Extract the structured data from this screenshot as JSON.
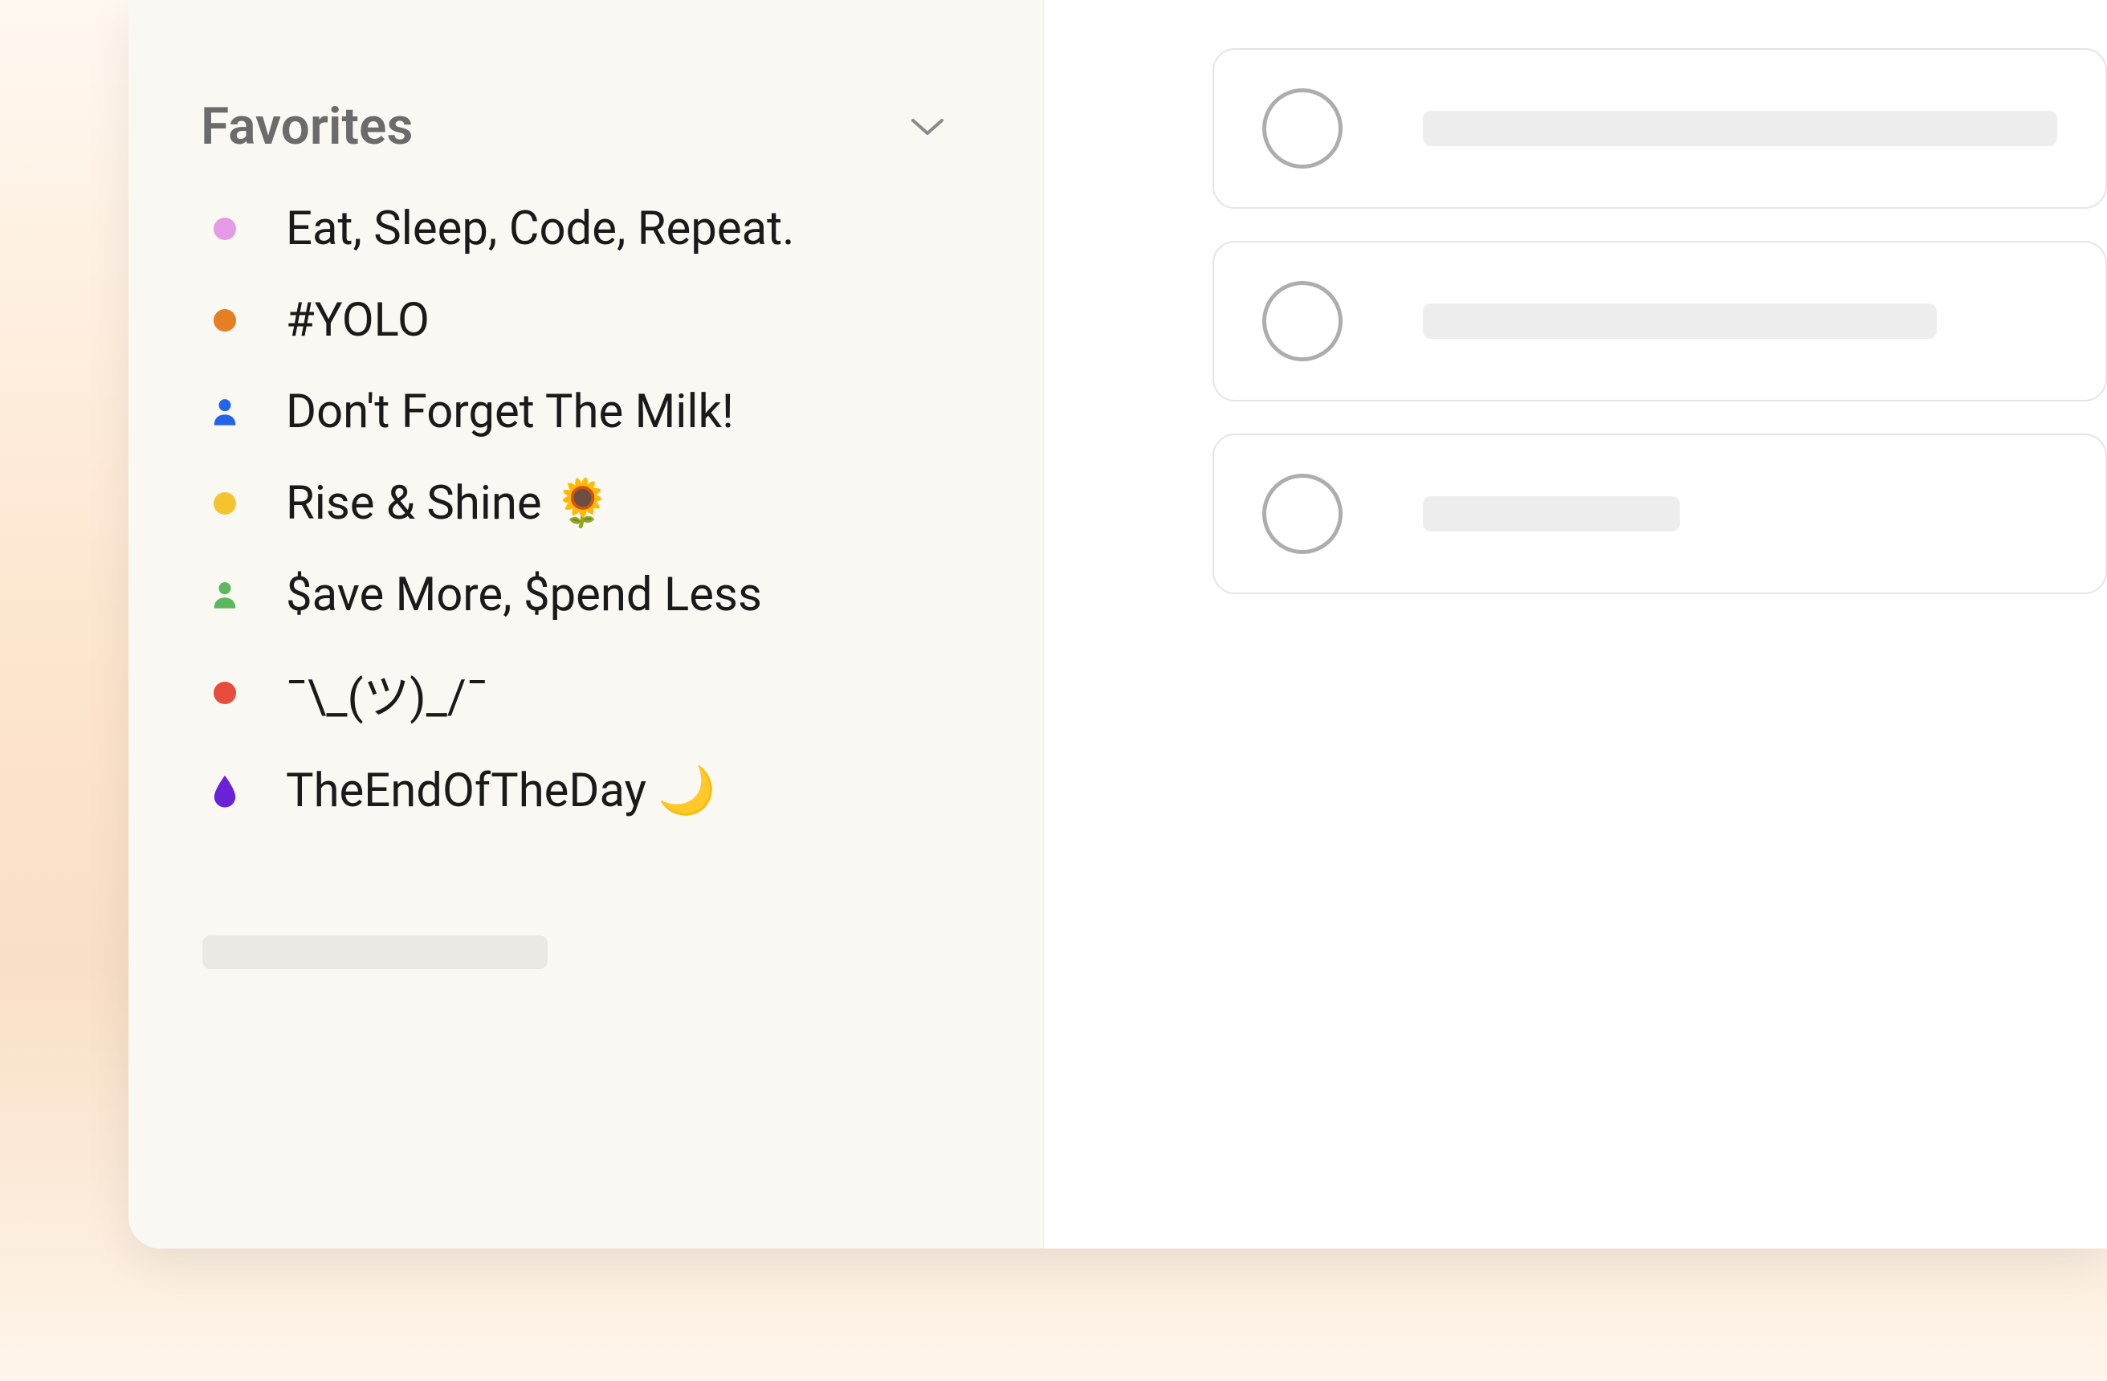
{
  "sidebar": {
    "section_title": "Favorites",
    "items": [
      {
        "label": "Eat, Sleep, Code, Repeat.",
        "icon_type": "dot",
        "color": "#e59ae5"
      },
      {
        "label": "#YOLO",
        "icon_type": "dot",
        "color": "#e67e22"
      },
      {
        "label": "Don't Forget The Milk!",
        "icon_type": "person",
        "color": "#2563eb"
      },
      {
        "label": "Rise & Shine 🌻",
        "icon_type": "dot",
        "color": "#f4c430"
      },
      {
        "label": "$ave More, $pend Less",
        "icon_type": "person",
        "color": "#5cb85c"
      },
      {
        "label": "¯\\_(ツ)_/¯",
        "icon_type": "dot",
        "color": "#e74c3c"
      },
      {
        "label": "TheEndOfTheDay 🌙",
        "icon_type": "drop",
        "color": "#6b21d6"
      }
    ]
  },
  "tasks": [
    {
      "placeholder_width": "w1"
    },
    {
      "placeholder_width": "w2"
    },
    {
      "placeholder_width": "w3"
    }
  ]
}
